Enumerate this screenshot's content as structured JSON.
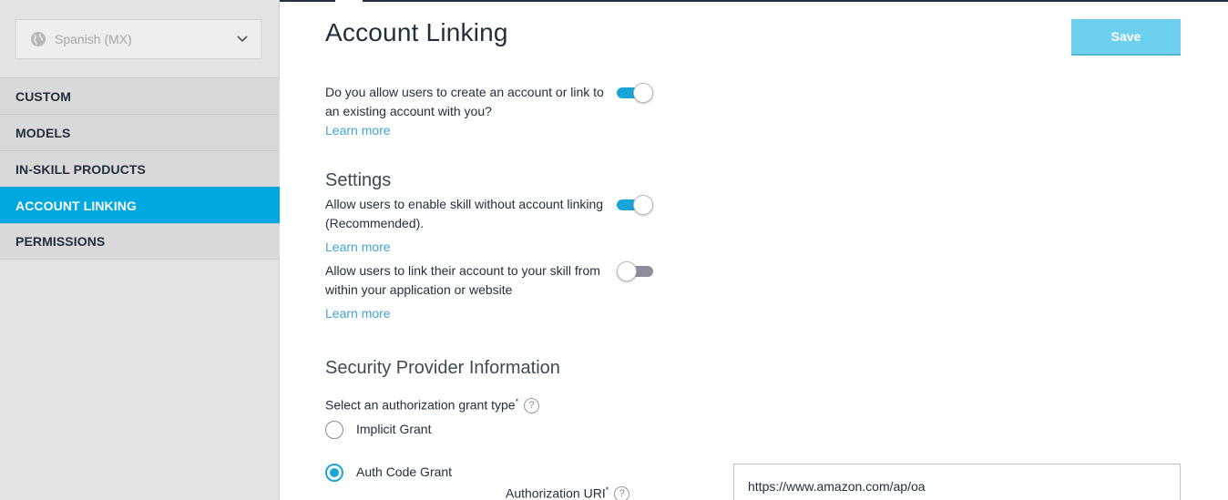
{
  "sidebar": {
    "language": "Spanish (MX)",
    "items": [
      {
        "label": "CUSTOM",
        "active": false
      },
      {
        "label": "MODELS",
        "active": false
      },
      {
        "label": "IN-SKILL PRODUCTS",
        "active": false
      },
      {
        "label": "ACCOUNT LINKING",
        "active": true
      },
      {
        "label": "PERMISSIONS",
        "active": false
      }
    ]
  },
  "header": {
    "title": "Account Linking",
    "save_label": "Save"
  },
  "main": {
    "allow_linking": {
      "question": "Do you allow users to create an account or link to an existing account with you?",
      "learn_more": "Learn more",
      "enabled": true
    },
    "settings": {
      "title": "Settings",
      "items": [
        {
          "text": "Allow users to enable skill without account linking (Recommended).",
          "learn_more": "Learn more",
          "enabled": true
        },
        {
          "text": "Allow users to link their account to your skill from within your application or website",
          "learn_more": "Learn more",
          "enabled": false
        }
      ]
    },
    "security": {
      "title": "Security Provider Information",
      "grant_label": "Select an authorization grant type",
      "required_mark": "*",
      "help": "?",
      "options": [
        {
          "label": "Implicit Grant",
          "selected": false
        },
        {
          "label": "Auth Code Grant",
          "selected": true
        }
      ],
      "auth_uri_label": "Authorization URI",
      "auth_uri_value": "https://www.amazon.com/ap/oa"
    }
  },
  "colors": {
    "accent": "#00a8e1",
    "toggle_on": "#1aa5d8",
    "toggle_off": "#8d8e9a",
    "save_button": "#6ed0ef",
    "link": "#45a6cf"
  }
}
